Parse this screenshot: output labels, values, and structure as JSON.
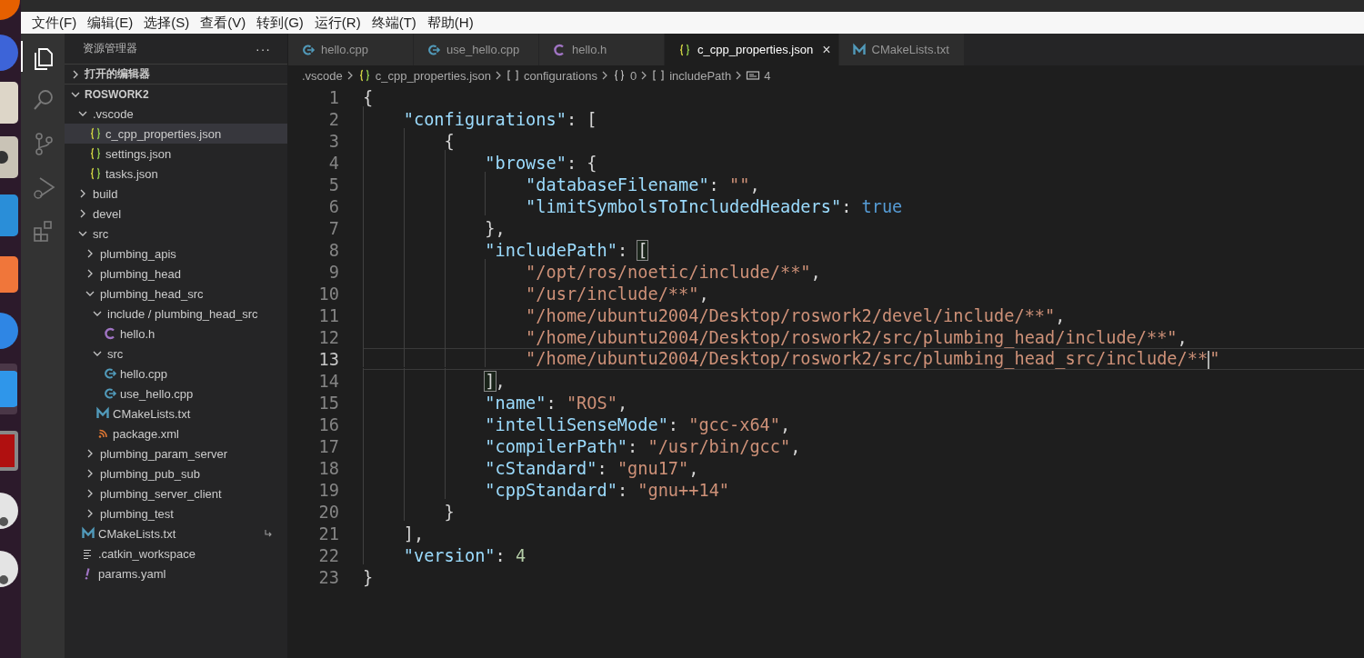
{
  "menu_bar": [
    "文件(F)",
    "编辑(E)",
    "选择(S)",
    "查看(V)",
    "转到(G)",
    "运行(R)",
    "终端(T)",
    "帮助(H)"
  ],
  "activity_bar": [
    {
      "kind": "explorer",
      "selected": true
    },
    {
      "kind": "search",
      "selected": false
    },
    {
      "kind": "source-control",
      "selected": false
    },
    {
      "kind": "run-debug",
      "selected": false
    },
    {
      "kind": "extensions",
      "selected": false
    }
  ],
  "sidebar": {
    "title": "资源管理器",
    "more": "···",
    "sections": [
      {
        "label": "打开的编辑器",
        "expanded": false
      },
      {
        "label": "ROSWORK2",
        "expanded": true
      }
    ],
    "tree": [
      {
        "label": ".vscode",
        "kind": "folder",
        "expanded": true,
        "selected": false,
        "children": [
          {
            "label": "c_cpp_properties.json",
            "kind": "json",
            "selected": true
          },
          {
            "label": "settings.json",
            "kind": "json",
            "selected": false
          },
          {
            "label": "tasks.json",
            "kind": "json",
            "selected": false
          }
        ]
      },
      {
        "label": "build",
        "kind": "folder",
        "expanded": false,
        "selected": false
      },
      {
        "label": "devel",
        "kind": "folder",
        "expanded": false,
        "selected": false
      },
      {
        "label": "src",
        "kind": "folder",
        "expanded": true,
        "selected": false,
        "children": [
          {
            "label": "plumbing_apis",
            "kind": "folder",
            "expanded": false,
            "selected": false
          },
          {
            "label": "plumbing_head",
            "kind": "folder",
            "expanded": false,
            "selected": false
          },
          {
            "label": "plumbing_head_src",
            "kind": "folder",
            "expanded": true,
            "selected": false,
            "children": [
              {
                "label": "include / plumbing_head_src",
                "kind": "folder",
                "expanded": true,
                "selected": false,
                "children": [
                  {
                    "label": "hello.h",
                    "kind": "c-header",
                    "selected": false
                  }
                ]
              },
              {
                "label": "src",
                "kind": "folder",
                "expanded": true,
                "selected": false,
                "children": [
                  {
                    "label": "hello.cpp",
                    "kind": "cpp",
                    "selected": false
                  },
                  {
                    "label": "use_hello.cpp",
                    "kind": "cpp",
                    "selected": false
                  }
                ]
              },
              {
                "label": "CMakeLists.txt",
                "kind": "cmake",
                "selected": false
              },
              {
                "label": "package.xml",
                "kind": "xml",
                "selected": false
              }
            ]
          },
          {
            "label": "plumbing_param_server",
            "kind": "folder",
            "expanded": false,
            "selected": false
          },
          {
            "label": "plumbing_pub_sub",
            "kind": "folder",
            "expanded": false,
            "selected": false
          },
          {
            "label": "plumbing_server_client",
            "kind": "folder",
            "expanded": false,
            "selected": false
          },
          {
            "label": "plumbing_test",
            "kind": "folder",
            "expanded": false,
            "selected": false
          }
        ]
      },
      {
        "label": "CMakeLists.txt",
        "kind": "cmake",
        "selected": false,
        "linked": true
      },
      {
        "label": ".catkin_workspace",
        "kind": "text",
        "selected": false
      },
      {
        "label": "params.yaml",
        "kind": "yaml",
        "selected": false
      }
    ]
  },
  "tabs": [
    {
      "label": "hello.cpp",
      "kind": "cpp",
      "selected": false
    },
    {
      "label": "use_hello.cpp",
      "kind": "cpp",
      "selected": false
    },
    {
      "label": "hello.h",
      "kind": "c-header",
      "selected": false
    },
    {
      "label": "c_cpp_properties.json",
      "kind": "json",
      "selected": true,
      "close": "×"
    },
    {
      "label": "CMakeLists.txt",
      "kind": "cmake",
      "selected": false
    }
  ],
  "breadcrumbs": [
    {
      "label": ".vscode",
      "kind": "folder"
    },
    {
      "label": "c_cpp_properties.json",
      "kind": "json"
    },
    {
      "label": "configurations",
      "kind": "array"
    },
    {
      "label": "0",
      "kind": "object"
    },
    {
      "label": "includePath",
      "kind": "array"
    },
    {
      "label": "4",
      "kind": "string"
    }
  ],
  "editor": {
    "lines": [
      {
        "number": "1",
        "current": false,
        "tokens": [
          {
            "kind": "punct",
            "text": "{"
          }
        ]
      },
      {
        "number": "2",
        "current": false,
        "tokens": [
          {
            "kind": "key",
            "text": "    \"configurations\""
          },
          {
            "kind": "punct",
            "text": ": ["
          }
        ]
      },
      {
        "number": "3",
        "current": false,
        "tokens": [
          {
            "kind": "punct",
            "text": "        {"
          }
        ]
      },
      {
        "number": "4",
        "current": false,
        "tokens": [
          {
            "kind": "key",
            "text": "            \"browse\""
          },
          {
            "kind": "punct",
            "text": ": {"
          }
        ]
      },
      {
        "number": "5",
        "current": false,
        "tokens": [
          {
            "kind": "key",
            "text": "                \"databaseFilename\""
          },
          {
            "kind": "punct",
            "text": ": "
          },
          {
            "kind": "string",
            "text": "\"\""
          },
          {
            "kind": "punct",
            "text": ","
          }
        ]
      },
      {
        "number": "6",
        "current": false,
        "tokens": [
          {
            "kind": "key",
            "text": "                \"limitSymbolsToIncludedHeaders\""
          },
          {
            "kind": "punct",
            "text": ": "
          },
          {
            "kind": "bool",
            "text": "true"
          }
        ]
      },
      {
        "number": "7",
        "current": false,
        "tokens": [
          {
            "kind": "punct",
            "text": "            },"
          }
        ]
      },
      {
        "number": "8",
        "current": false,
        "tokens": [
          {
            "kind": "key",
            "text": "            \"includePath\""
          },
          {
            "kind": "punct",
            "text": ": "
          },
          {
            "kind": "punct",
            "text": "[",
            "matched": true
          }
        ]
      },
      {
        "number": "9",
        "current": false,
        "tokens": [
          {
            "kind": "string",
            "text": "                \"/opt/ros/noetic/include/**\""
          },
          {
            "kind": "punct",
            "text": ","
          }
        ]
      },
      {
        "number": "10",
        "current": false,
        "tokens": [
          {
            "kind": "string",
            "text": "                \"/usr/include/**\""
          },
          {
            "kind": "punct",
            "text": ","
          }
        ]
      },
      {
        "number": "11",
        "current": false,
        "tokens": [
          {
            "kind": "string",
            "text": "                \"/home/ubuntu2004/Desktop/roswork2/devel/include/**\""
          },
          {
            "kind": "punct",
            "text": ","
          }
        ]
      },
      {
        "number": "12",
        "current": false,
        "tokens": [
          {
            "kind": "string",
            "text": "                \"/home/ubuntu2004/Desktop/roswork2/src/plumbing_head/include/**\""
          },
          {
            "kind": "punct",
            "text": ","
          }
        ]
      },
      {
        "number": "13",
        "current": true,
        "tokens": [
          {
            "kind": "string",
            "text": "                \"/home/ubuntu2004/Desktop/roswork2/src/plumbing_head_src/include/**"
          },
          {
            "kind": "string",
            "text": "\"",
            "caret": true
          }
        ]
      },
      {
        "number": "14",
        "current": false,
        "tokens": [
          {
            "kind": "punct",
            "text": "            ]",
            "matched": true
          },
          {
            "kind": "punct",
            "text": ","
          }
        ]
      },
      {
        "number": "15",
        "current": false,
        "tokens": [
          {
            "kind": "key",
            "text": "            \"name\""
          },
          {
            "kind": "punct",
            "text": ": "
          },
          {
            "kind": "string",
            "text": "\"ROS\""
          },
          {
            "kind": "punct",
            "text": ","
          }
        ]
      },
      {
        "number": "16",
        "current": false,
        "tokens": [
          {
            "kind": "key",
            "text": "            \"intelliSenseMode\""
          },
          {
            "kind": "punct",
            "text": ": "
          },
          {
            "kind": "string",
            "text": "\"gcc-x64\""
          },
          {
            "kind": "punct",
            "text": ","
          }
        ]
      },
      {
        "number": "17",
        "current": false,
        "tokens": [
          {
            "kind": "key",
            "text": "            \"compilerPath\""
          },
          {
            "kind": "punct",
            "text": ": "
          },
          {
            "kind": "string",
            "text": "\"/usr/bin/gcc\""
          },
          {
            "kind": "punct",
            "text": ","
          }
        ]
      },
      {
        "number": "18",
        "current": false,
        "tokens": [
          {
            "kind": "key",
            "text": "            \"cStandard\""
          },
          {
            "kind": "punct",
            "text": ": "
          },
          {
            "kind": "string",
            "text": "\"gnu17\""
          },
          {
            "kind": "punct",
            "text": ","
          }
        ]
      },
      {
        "number": "19",
        "current": false,
        "tokens": [
          {
            "kind": "key",
            "text": "            \"cppStandard\""
          },
          {
            "kind": "punct",
            "text": ": "
          },
          {
            "kind": "string",
            "text": "\"gnu++14\""
          }
        ]
      },
      {
        "number": "20",
        "current": false,
        "tokens": [
          {
            "kind": "punct",
            "text": "        }"
          }
        ]
      },
      {
        "number": "21",
        "current": false,
        "tokens": [
          {
            "kind": "punct",
            "text": "    ],"
          }
        ]
      },
      {
        "number": "22",
        "current": false,
        "tokens": [
          {
            "kind": "key",
            "text": "    \"version\""
          },
          {
            "kind": "punct",
            "text": ": "
          },
          {
            "kind": "number",
            "text": "4"
          }
        ]
      },
      {
        "number": "23",
        "current": false,
        "tokens": [
          {
            "kind": "punct",
            "text": "}"
          }
        ]
      }
    ]
  }
}
